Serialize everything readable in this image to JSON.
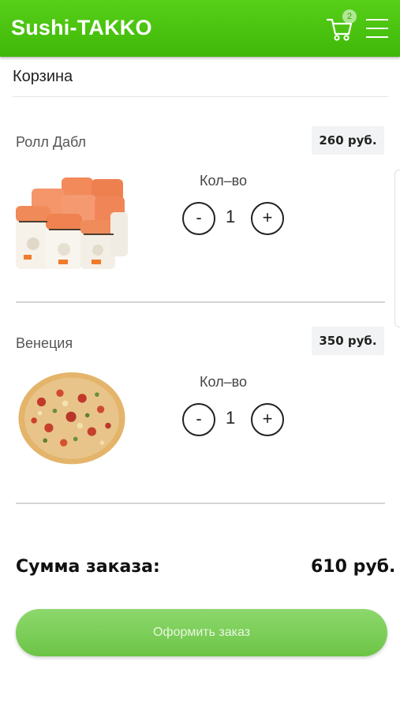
{
  "header": {
    "brand": "Sushi-TAKKO",
    "cart_count": "2",
    "cart_icon": "cart-icon",
    "menu_icon": "hamburger-menu-icon",
    "color": "#4cc412"
  },
  "page": {
    "title": "Корзина"
  },
  "items": [
    {
      "name": "Ролл Дабл",
      "price": "260 руб.",
      "qty_label": "Кол–во",
      "qty": "1",
      "minus": "-",
      "plus": "+"
    },
    {
      "name": "Венеция",
      "price": "350 руб.",
      "qty_label": "Кол–во",
      "qty": "1",
      "minus": "-",
      "plus": "+"
    }
  ],
  "summary": {
    "label": "Сумма заказа:",
    "value": "610 руб."
  },
  "checkout": {
    "label": "Оформить заказ",
    "color": "#7ccf58"
  }
}
